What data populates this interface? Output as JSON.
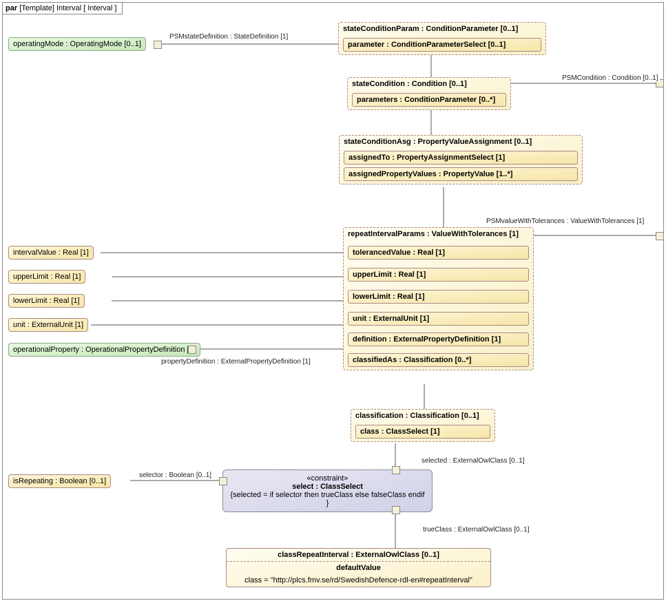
{
  "frame": {
    "kind": "par",
    "template": "[Template] Interval",
    "name": "[ Interval ]"
  },
  "leftBoxes": {
    "operatingMode": "operatingMode : OperatingMode [0..1]",
    "intervalValue": "intervalValue : Real [1]",
    "upperLimit": "upperLimit : Real [1]",
    "lowerLimit": "lowerLimit : Real [1]",
    "unit": "unit : ExternalUnit [1]",
    "operationalProperty": "operationalProperty : OperationalPropertyDefinition [1]",
    "isRepeating": "isRepeating : Boolean [0..1]"
  },
  "containers": {
    "stateConditionParam": {
      "title": "stateConditionParam : ConditionParameter [0..1]",
      "inner": {
        "parameter": "parameter : ConditionParameterSelect [0..1]"
      }
    },
    "stateCondition": {
      "title": "stateCondition : Condition [0..1]",
      "inner": {
        "parameters": "parameters : ConditionParameter [0..*]"
      }
    },
    "stateConditionAsg": {
      "title": "stateConditionAsg : PropertyValueAssignment [0..1]",
      "inner": {
        "assignedTo": "assignedTo : PropertyAssignmentSelect [1]",
        "assignedPropertyValues": "assignedPropertyValues : PropertyValue [1..*]"
      }
    },
    "repeatIntervalParams": {
      "title": "repeatIntervalParams : ValueWithTolerances [1]",
      "inner": {
        "tolerancedValue": "tolerancedValue : Real [1]",
        "upperLimit": "upperLimit : Real [1]",
        "lowerLimit": "lowerLimit : Real [1]",
        "unit": "unit : ExternalUnit [1]",
        "definition": "definition : ExternalPropertyDefinition [1]",
        "classifiedAs": "classifiedAs : Classification [0..*]"
      }
    },
    "classification": {
      "title": "classification : Classification [0..1]",
      "inner": {
        "class": "class : ClassSelect [1]"
      }
    }
  },
  "constraint": {
    "stereotype": "«constraint»",
    "name": "select : ClassSelect",
    "body": "{selected = if selector then trueClass else falseClass endif }"
  },
  "classRepeatInterval": {
    "title": "classRepeatInterval : ExternalOwlClass [0..1]",
    "section": "defaultValue",
    "body": "class = \"http://plcs.fmv.se/rd/SwedishDefence-rdl-en#repeatInterval\""
  },
  "connLabels": {
    "psmStateDefinition": "PSMstateDefinition : StateDefinition [1]",
    "psmCondition": "PSMCondition : Condition [0..1]",
    "psmValueWithTolerances": "PSMvalueWithTolerances : ValueWithTolerances [1]",
    "propertyDefinition": "propertyDefinition : ExternalPropertyDefinition [1]",
    "selector": "selector : Boolean [0..1]",
    "selected": "selected : ExternalOwlClass [0..1]",
    "trueClass": "trueClass : ExternalOwlClass [0..1]"
  }
}
